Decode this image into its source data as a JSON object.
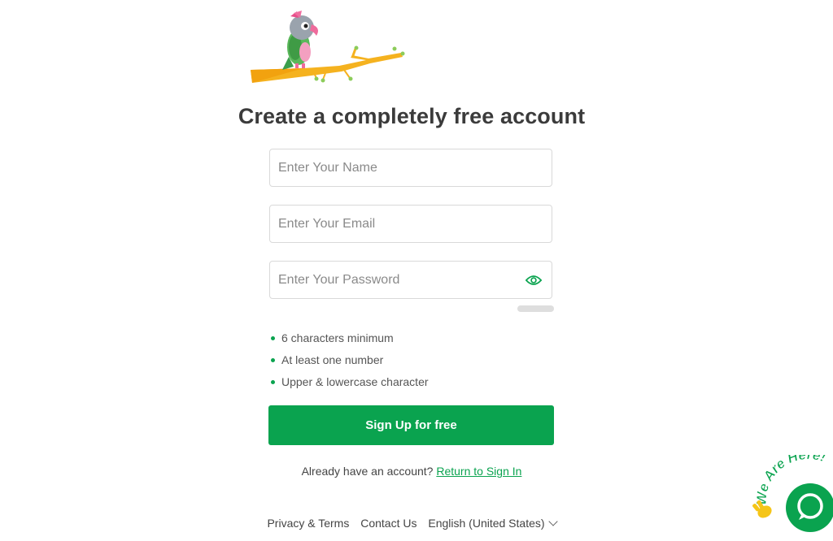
{
  "page": {
    "title": "Create a completely free account"
  },
  "form": {
    "name_placeholder": "Enter Your Name",
    "email_placeholder": "Enter Your Email",
    "password_placeholder": "Enter Your Password",
    "password_rules": [
      "6 characters minimum",
      "At least one number",
      "Upper & lowercase character"
    ],
    "submit_label": "Sign Up for free"
  },
  "signin": {
    "prompt": "Already have an account?",
    "link": "Return to Sign In"
  },
  "footer": {
    "privacy": "Privacy & Terms",
    "contact": "Contact Us",
    "language": "English (United States)"
  },
  "chat_widget": {
    "badge_text": "We Are Here!"
  },
  "icons": {
    "logo": "parrot-on-branch-logo",
    "password_toggle": "eye-icon",
    "chat": "chat-bubble-icon",
    "wave": "waving-hand-icon",
    "language": "chevron-down-icon"
  },
  "colors": {
    "accent": "#0aa34f",
    "title": "#3b3b3b"
  }
}
